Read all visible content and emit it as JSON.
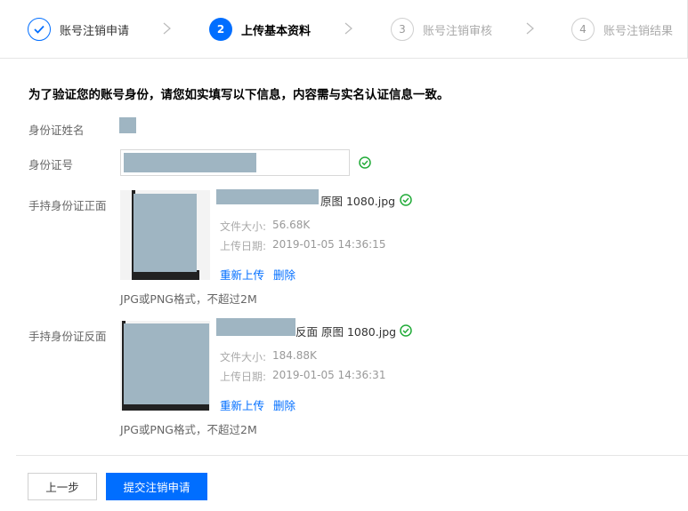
{
  "steps": [
    {
      "number": "✓",
      "label": "账号注销申请",
      "state": "done"
    },
    {
      "number": "2",
      "label": "上传基本资料",
      "state": "active"
    },
    {
      "number": "3",
      "label": "账号注销审核",
      "state": "todo"
    },
    {
      "number": "4",
      "label": "账号注销结果",
      "state": "todo"
    }
  ],
  "notice": "为了验证您的账号身份，请您如实填写以下信息，内容需与实名认证信息一致。",
  "fields": {
    "name_label": "身份证姓名",
    "id_label": "身份证号",
    "front_label": "手持身份证正面",
    "back_label": "手持身份证反面"
  },
  "front": {
    "file_name_suffix": "原图 1080.jpg",
    "size_label": "文件大小:",
    "size_value": "56.68K",
    "date_label": "上传日期:",
    "date_value": "2019-01-05 14:36:15",
    "reupload": "重新上传",
    "delete": "删除",
    "hint": "JPG或PNG格式，不超过2M"
  },
  "back": {
    "file_name_suffix": "反面 原图 1080.jpg",
    "size_label": "文件大小:",
    "size_value": "184.88K",
    "date_label": "上传日期:",
    "date_value": "2019-01-05 14:36:31",
    "reupload": "重新上传",
    "delete": "删除",
    "hint": "JPG或PNG格式，不超过2M"
  },
  "buttons": {
    "prev": "上一步",
    "submit": "提交注销申请"
  },
  "colors": {
    "accent": "#006eff",
    "success": "#22ab39",
    "redacted": "#9fb5c2"
  }
}
